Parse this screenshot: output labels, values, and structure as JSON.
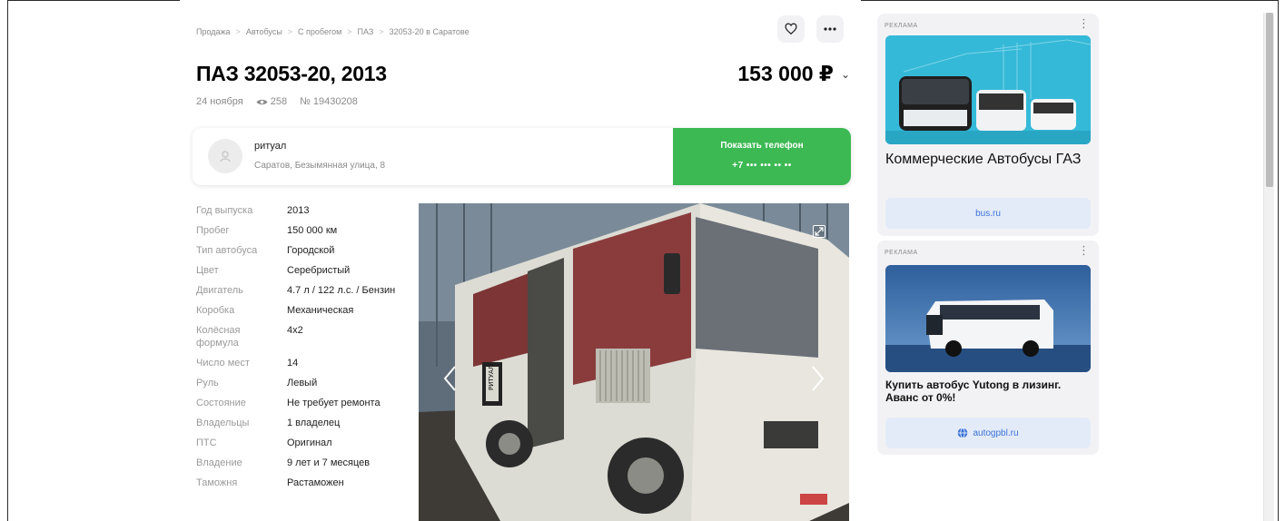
{
  "breadcrumb": [
    "Продажа",
    "Автобусы",
    "С пробегом",
    "ПАЗ",
    "32053-20 в Саратове"
  ],
  "listing": {
    "title": "ПАЗ 32053-20, 2013",
    "price": "153 000 ₽",
    "date": "24 ноября",
    "views": "258",
    "id": "№ 19430208"
  },
  "seller": {
    "name": "ритуал",
    "address": "Саратов, Безымянная улица, 8",
    "phone_label": "Показать телефон",
    "phone_masked": "+7 ••• ••• •• ••"
  },
  "specs": [
    {
      "key": "Год выпуска",
      "value": "2013"
    },
    {
      "key": "Пробег",
      "value": "150 000 км"
    },
    {
      "key": "Тип автобуса",
      "value": "Городской"
    },
    {
      "key": "Цвет",
      "value": "Серебристый"
    },
    {
      "key": "Двигатель",
      "value": "4.7 л / 122 л.с. / Бензин"
    },
    {
      "key": "Коробка",
      "value": "Механическая"
    },
    {
      "key": "Колёсная формула",
      "value": "4x2"
    },
    {
      "key": "Число мест",
      "value": "14"
    },
    {
      "key": "Руль",
      "value": "Левый"
    },
    {
      "key": "Состояние",
      "value": "Не требует ремонта"
    },
    {
      "key": "Владельцы",
      "value": "1 владелец"
    },
    {
      "key": "ПТС",
      "value": "Оригинал"
    },
    {
      "key": "Владение",
      "value": "9 лет и 7 месяцев"
    },
    {
      "key": "Таможня",
      "value": "Растаможен"
    }
  ],
  "photo": {
    "bus_sign": "РИТУАЛ"
  },
  "ads": [
    {
      "label": "РЕКЛАМА",
      "title": "Коммерческие Автобусы ГАЗ",
      "link": "bus.ru"
    },
    {
      "label": "РЕКЛАМА",
      "title": "Купить автобус Yutong в лизинг. Аванс от 0%!",
      "link": "autogpbl.ru"
    }
  ],
  "colors": {
    "accent_green": "#3db954",
    "ad_link_blue": "#3a72d8"
  }
}
